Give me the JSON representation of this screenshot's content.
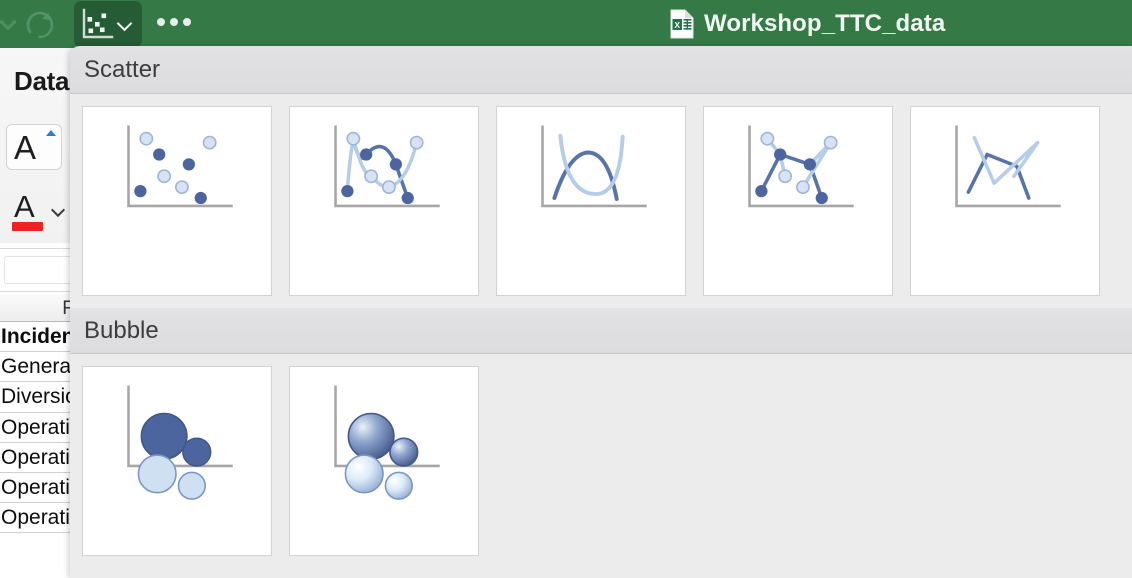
{
  "titlebar": {
    "refresh_icon": "refresh-icon",
    "back_caret_icon": "caret-left-icon",
    "chart_type_button": {
      "icon": "scatter-chart-icon",
      "chevron": "chevron-down-icon",
      "state": "pressed"
    },
    "overflow_label": "overflow-dots-icon",
    "file_icon": "excel-file-icon",
    "document_title": "Workshop_TTC_data",
    "bg_color": "#357a46",
    "pressed_color": "#255c35"
  },
  "ribbon": {
    "tab_label": "Data",
    "grow_font": {
      "glyph": "A",
      "icon": "font-grow-icon"
    },
    "font_color": {
      "glyph": "A",
      "icon": "font-color-icon",
      "color": "#ee2222",
      "chevron": "chevron-down-icon"
    }
  },
  "sheet": {
    "column_headers": [
      "F"
    ],
    "rows": [
      {
        "text": "Incident",
        "bold": true
      },
      {
        "text": "General ",
        "bold": false
      },
      {
        "text": "Diversion",
        "bold": false
      },
      {
        "text": "Operatio",
        "bold": false
      },
      {
        "text": "Operatio",
        "bold": false
      },
      {
        "text": "Operatio",
        "bold": false
      },
      {
        "text": "Operatio",
        "bold": false
      }
    ]
  },
  "gallery": {
    "sections": [
      {
        "title": "Scatter",
        "items": [
          {
            "name": "scatter-markers-only",
            "type": "scatter-points"
          },
          {
            "name": "scatter-smooth-lines-markers",
            "type": "scatter-smooth-markers"
          },
          {
            "name": "scatter-smooth-lines",
            "type": "scatter-smooth"
          },
          {
            "name": "scatter-straight-lines-markers",
            "type": "scatter-straight-markers"
          },
          {
            "name": "scatter-straight-lines",
            "type": "scatter-straight"
          }
        ]
      },
      {
        "title": "Bubble",
        "items": [
          {
            "name": "bubble-chart",
            "type": "bubble-flat"
          },
          {
            "name": "bubble-3d-chart",
            "type": "bubble-3d"
          }
        ]
      }
    ],
    "palette": {
      "dark_marker": "#4d659e",
      "light_marker": "#d7e3f4",
      "dark_line": "#5873ab",
      "light_line": "#b6cdea",
      "axis": "#a6a6a6",
      "panel_bg": "#ececec",
      "header_bg": "#dedee0"
    }
  }
}
